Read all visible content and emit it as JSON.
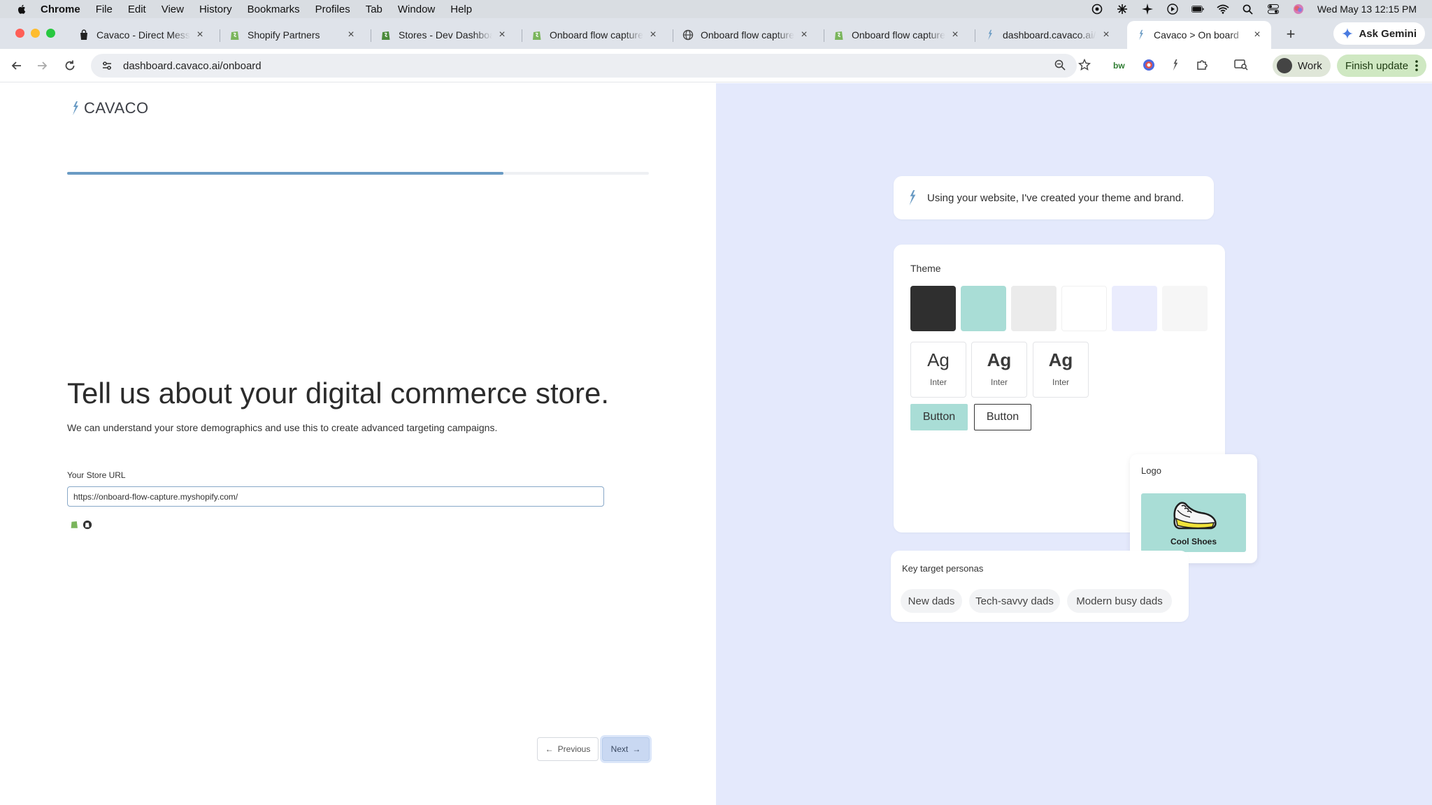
{
  "menubar": {
    "app": "Chrome",
    "items": [
      "File",
      "Edit",
      "View",
      "History",
      "Bookmarks",
      "Profiles",
      "Tab",
      "Window",
      "Help"
    ],
    "datetime": "Wed May 13  12:15 PM"
  },
  "tabs": [
    {
      "title": "Cavaco - Direct Messa",
      "favicon": "cavaco-bag-icon"
    },
    {
      "title": "Shopify Partners",
      "favicon": "shopify-icon"
    },
    {
      "title": "Stores - Dev Dashboard",
      "favicon": "shopify-icon"
    },
    {
      "title": "Onboard flow capture",
      "favicon": "shopify-icon"
    },
    {
      "title": "Onboard flow capture",
      "favicon": "globe-icon"
    },
    {
      "title": "Onboard flow capture",
      "favicon": "shopify-icon"
    },
    {
      "title": "dashboard.cavaco.ai/s",
      "favicon": "cavaco-mark-icon"
    },
    {
      "title": "Cavaco > On board",
      "favicon": "cavaco-mark-icon"
    }
  ],
  "ask_gemini": "Ask Gemini",
  "address": {
    "url": "dashboard.cavaco.ai/onboard"
  },
  "profile": {
    "label": "Work"
  },
  "update_button": "Finish update",
  "onboard": {
    "brand": "CAVACO",
    "progress": 0.75,
    "headline": "Tell us about your digital commerce store.",
    "subline": "We can understand your store demographics and use this to create advanced targeting campaigns.",
    "url_label": "Your Store URL",
    "url_value": "https://onboard-flow-capture.myshopify.com/",
    "prev_label": "Previous",
    "next_label": "Next"
  },
  "preview": {
    "assistant_message": "Using your website, I've created your theme and brand.",
    "theme_title": "Theme",
    "swatches": [
      "#2f2f2f",
      "#a9ddd6",
      "#ebebeb",
      "#ffffff",
      "#eaecfd",
      "#f6f6f6"
    ],
    "fonts": [
      {
        "sample": "Ag",
        "name": "Inter",
        "weight": "normal"
      },
      {
        "sample": "Ag",
        "name": "Inter",
        "weight": "bold"
      },
      {
        "sample": "Ag",
        "name": "Inter",
        "weight": "bold"
      }
    ],
    "button_filled": "Button",
    "button_outline": "Button",
    "logo_title": "Logo",
    "logo_brand": "Cool Shoes",
    "personas_title": "Key target personas",
    "personas": [
      "New dads",
      "Tech-savvy dads",
      "Modern busy dads"
    ]
  },
  "colors": {
    "accent_teal": "#a9ddd6",
    "panel_bg": "#e4e9fc",
    "progress": "#6a9bc4"
  }
}
